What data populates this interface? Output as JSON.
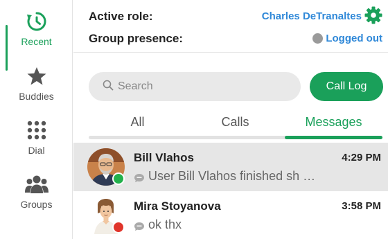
{
  "sidebar": {
    "items": [
      {
        "label": "Recent",
        "icon": "history-icon",
        "active": true
      },
      {
        "label": "Buddies",
        "icon": "star-icon",
        "active": false
      },
      {
        "label": "Dial",
        "icon": "dialpad-icon",
        "active": false
      },
      {
        "label": "Groups",
        "icon": "groups-icon",
        "active": false
      }
    ]
  },
  "header": {
    "active_role_label": "Active role:",
    "active_role_value": "Charles DeTranaltes",
    "group_presence_label": "Group presence:",
    "presence_value": "Logged out",
    "settings_icon": "gear-icon"
  },
  "search": {
    "placeholder": "Search",
    "value": ""
  },
  "call_log_label": "Call Log",
  "tabs": [
    {
      "label": "All",
      "active": false
    },
    {
      "label": "Calls",
      "active": false
    },
    {
      "label": "Messages",
      "active": true
    }
  ],
  "conversations": [
    {
      "name": "Bill Vlahos",
      "time": "4:29 PM",
      "preview": "User Bill Vlahos finished sh …",
      "status": "online",
      "selected": true
    },
    {
      "name": "Mira Stoyanova",
      "time": "3:58 PM",
      "preview": "ok thx",
      "status": "busy",
      "selected": false
    }
  ],
  "colors": {
    "accent_green": "#1aa05a",
    "link_blue": "#2f88d8",
    "presence_gray": "#9a9a9a",
    "online_green": "#22b14c",
    "busy_red": "#e0352b"
  }
}
